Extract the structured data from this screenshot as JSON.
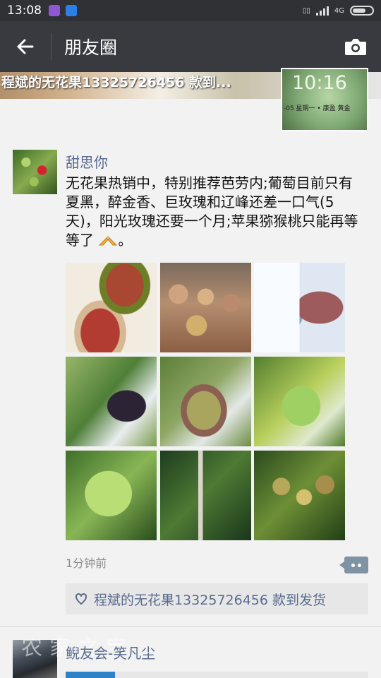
{
  "status": {
    "time": "13:08",
    "network": "4G",
    "signal_bars": 4,
    "battery_level": 0.62
  },
  "nav": {
    "title": "朋友圈",
    "back_icon": "back-arrow-icon",
    "camera_icon": "camera-icon"
  },
  "cover": {
    "text": "程斌的无花果13325726456 款到...",
    "clock": "10:16",
    "date": "-05  星期一  • 康盈  黄金"
  },
  "post": {
    "author": "甜思你",
    "text": "无花果热销中，特别推荐芭劳内;葡萄目前只有夏黑，醉金香、巨玫瑰和辽峰还差一口气(5天)，阳光玫瑰还要一个月;苹果猕猴桃只能再等等了",
    "text_end": "。",
    "photos": [
      "figs-cut",
      "figs-basket",
      "refractometer-fig",
      "dark-grapes",
      "green-red-grapes",
      "green-grapes-vine",
      "green-grapes-bunch",
      "orchard-trees",
      "fruit-on-branch"
    ],
    "time": "1分钟前",
    "likes": "程斌的无花果13325726456 款到发货"
  },
  "next_post": {
    "author": "鲵友会-笑凡尘",
    "watermark": "农家之宝"
  }
}
